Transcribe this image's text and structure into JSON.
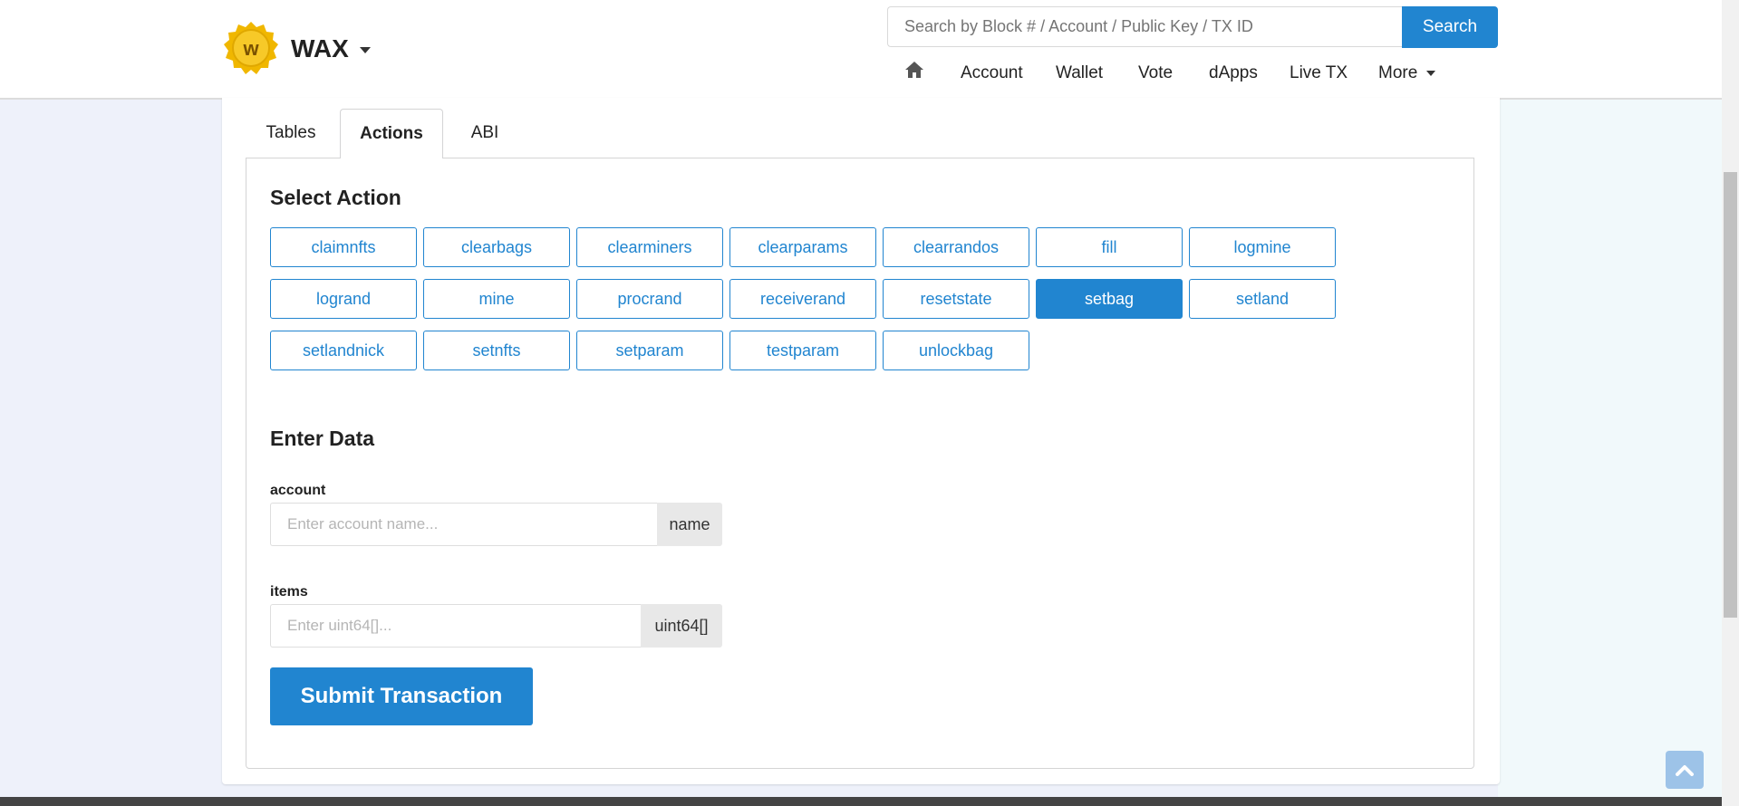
{
  "header": {
    "logo_text": "WAX",
    "search_placeholder": "Search by Block # / Account / Public Key / TX ID",
    "search_button": "Search",
    "nav": [
      "Account",
      "Wallet",
      "Vote",
      "dApps",
      "Live TX",
      "More"
    ]
  },
  "tabs": [
    {
      "label": "Tables",
      "active": false
    },
    {
      "label": "Actions",
      "active": true
    },
    {
      "label": "ABI",
      "active": false
    }
  ],
  "select_action": {
    "title": "Select Action",
    "actions": [
      "claimnfts",
      "clearbags",
      "clearminers",
      "clearparams",
      "clearrandos",
      "fill",
      "logmine",
      "logrand",
      "mine",
      "procrand",
      "receiverand",
      "resetstate",
      "setbag",
      "setland",
      "setlandnick",
      "setnfts",
      "setparam",
      "testparam",
      "unlockbag"
    ],
    "selected": "setbag"
  },
  "enter_data": {
    "title": "Enter Data",
    "fields": [
      {
        "label": "account",
        "placeholder": "Enter account name...",
        "type": "name",
        "value": ""
      },
      {
        "label": "items",
        "placeholder": "Enter uint64[]...",
        "type": "uint64[]",
        "value": ""
      }
    ]
  },
  "submit_label": "Submit Transaction",
  "colors": {
    "accent": "#2185d0",
    "logo_gold": "#f5c518"
  },
  "icons": [
    "wax-logo-icon",
    "home-icon",
    "chevron-down-icon",
    "arrow-up-icon"
  ]
}
